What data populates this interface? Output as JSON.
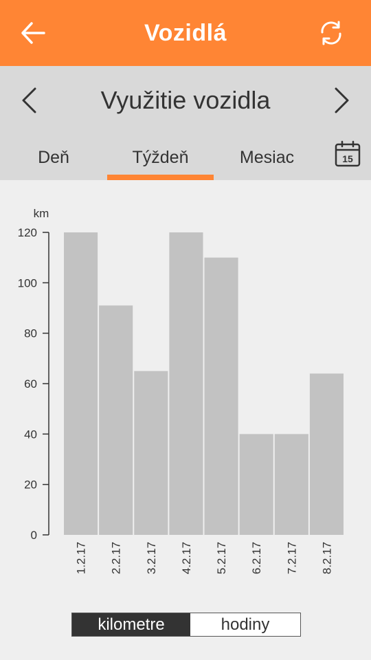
{
  "appbar": {
    "title": "Vozidlá",
    "back_icon": "arrow-left-icon",
    "refresh_icon": "refresh-icon",
    "color": "#ff8534"
  },
  "nav": {
    "title": "Využitie vozidla",
    "prev_icon": "chevron-left-icon",
    "next_icon": "chevron-right-icon"
  },
  "tabs": [
    {
      "label": "Deň",
      "selected": false
    },
    {
      "label": "Týždeň",
      "selected": true
    },
    {
      "label": "Mesiac",
      "selected": false
    }
  ],
  "calendar_icon": {
    "icon": "calendar-icon",
    "label": "15"
  },
  "chart_data": {
    "type": "bar",
    "ylabel": "km",
    "ylim": [
      0,
      120
    ],
    "yticks": [
      0,
      20,
      40,
      60,
      80,
      100,
      120
    ],
    "categories": [
      "1.2.17",
      "2.2.17",
      "3.2.17",
      "4.2.17",
      "5.2.17",
      "6.2.17",
      "7.2.17",
      "8.2.17"
    ],
    "values": [
      120,
      91,
      65,
      120,
      110,
      40,
      40,
      64
    ],
    "bar_color": "#c2c2c2",
    "grid": false
  },
  "toggle": {
    "options": [
      {
        "label": "kilometre",
        "selected": true
      },
      {
        "label": "hodiny",
        "selected": false
      }
    ]
  }
}
